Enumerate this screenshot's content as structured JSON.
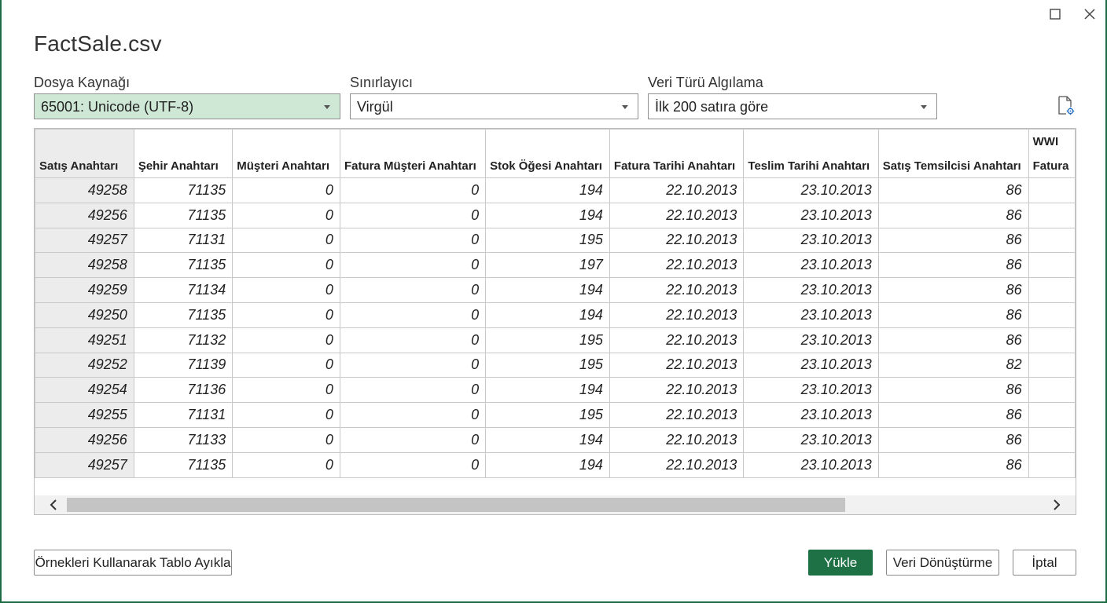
{
  "window": {
    "title": "FactSale.csv",
    "maximize_icon": "maximize-icon",
    "close_icon": "close-icon"
  },
  "fields": {
    "file_origin": {
      "label": "Dosya Kaynağı",
      "value": "65001: Unicode (UTF-8)"
    },
    "delimiter": {
      "label": "Sınırlayıcı",
      "value": "Virgül"
    },
    "data_type_detection": {
      "label": "Veri Türü Algılama",
      "value": "İlk 200 satıra göre"
    }
  },
  "settings_icon": "document-settings-icon",
  "table": {
    "columns": [
      {
        "label": "Satış Anahtarı",
        "top": ""
      },
      {
        "label": "Şehir Anahtarı",
        "top": ""
      },
      {
        "label": "Müşteri Anahtarı",
        "top": ""
      },
      {
        "label": "Fatura Müşteri Anahtarı",
        "top": ""
      },
      {
        "label": "Stok Öğesi Anahtarı",
        "top": ""
      },
      {
        "label": "Fatura Tarihi Anahtarı",
        "top": ""
      },
      {
        "label": "Teslim Tarihi Anahtarı",
        "top": ""
      },
      {
        "label": "Satış Temsilcisi Anahtarı",
        "top": ""
      },
      {
        "label": "Fatura",
        "top": "WWI"
      }
    ],
    "rows": [
      [
        "49258",
        "71135",
        "0",
        "0",
        "194",
        "22.10.2013",
        "23.10.2013",
        "86",
        ""
      ],
      [
        "49256",
        "71135",
        "0",
        "0",
        "194",
        "22.10.2013",
        "23.10.2013",
        "86",
        ""
      ],
      [
        "49257",
        "71131",
        "0",
        "0",
        "195",
        "22.10.2013",
        "23.10.2013",
        "86",
        ""
      ],
      [
        "49258",
        "71135",
        "0",
        "0",
        "197",
        "22.10.2013",
        "23.10.2013",
        "86",
        ""
      ],
      [
        "49259",
        "71134",
        "0",
        "0",
        "194",
        "22.10.2013",
        "23.10.2013",
        "86",
        ""
      ],
      [
        "49250",
        "71135",
        "0",
        "0",
        "194",
        "22.10.2013",
        "23.10.2013",
        "86",
        ""
      ],
      [
        "49251",
        "71132",
        "0",
        "0",
        "195",
        "22.10.2013",
        "23.10.2013",
        "86",
        ""
      ],
      [
        "49252",
        "71139",
        "0",
        "0",
        "195",
        "22.10.2013",
        "23.10.2013",
        "82",
        ""
      ],
      [
        "49254",
        "71136",
        "0",
        "0",
        "194",
        "22.10.2013",
        "23.10.2013",
        "86",
        ""
      ],
      [
        "49255",
        "71131",
        "0",
        "0",
        "195",
        "22.10.2013",
        "23.10.2013",
        "86",
        ""
      ],
      [
        "49256",
        "71133",
        "0",
        "0",
        "194",
        "22.10.2013",
        "23.10.2013",
        "86",
        ""
      ],
      [
        "49257",
        "71135",
        "0",
        "0",
        "194",
        "22.10.2013",
        "23.10.2013",
        "86",
        ""
      ]
    ]
  },
  "buttons": {
    "extract": "Örnekleri Kullanarak Tablo Ayıkla",
    "load": "Yükle",
    "transform": "Veri Dönüştürme",
    "cancel": "İptal"
  },
  "colors": {
    "accent": "#1e7145",
    "active_field": "#cfe8d6"
  }
}
